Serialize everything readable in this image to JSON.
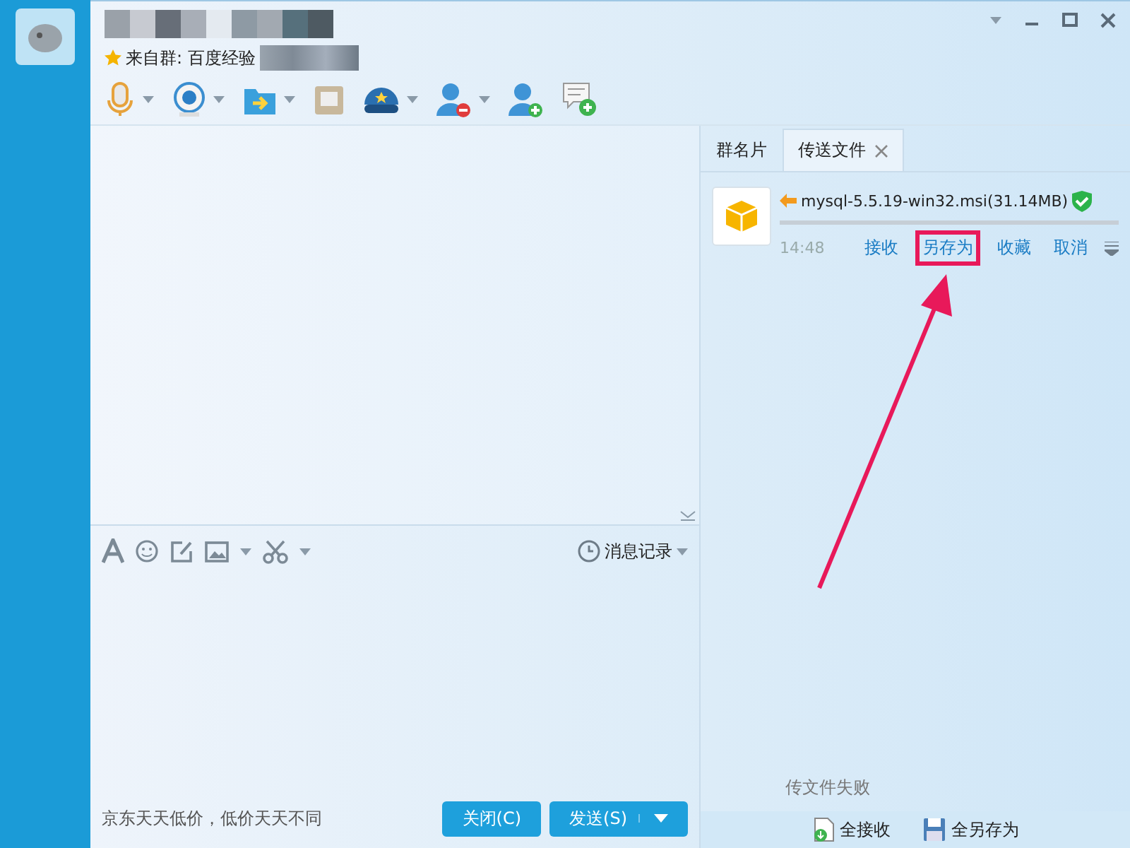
{
  "header": {
    "from_group": "来自群: 百度经验"
  },
  "tabs": [
    {
      "label": "群名片",
      "selected": false,
      "closable": false
    },
    {
      "label": "传送文件",
      "selected": true,
      "closable": true
    }
  ],
  "transfer": {
    "filename": "mysql-5.5.19-win32.msi(31.14MB)",
    "time": "14:48",
    "level": 0,
    "actions": [
      {
        "label": "接收",
        "highlighted": false
      },
      {
        "label": "另存为",
        "highlighted": true
      },
      {
        "label": "收藏",
        "highlighted": false
      },
      {
        "label": "取消",
        "highlighted": false
      }
    ]
  },
  "format_toolbar": {
    "history": "消息记录"
  },
  "footer": {
    "ad": "京东天天低价，低价天天不同",
    "buttons": [
      {
        "label": "关闭(C)",
        "kind": "plain"
      },
      {
        "label": "发送(S)",
        "kind": "split"
      }
    ]
  },
  "side_status": "传文件失败",
  "side_actions": [
    {
      "label": "全接收",
      "kind": "receive"
    },
    {
      "label": "全另存为",
      "kind": "save"
    }
  ]
}
